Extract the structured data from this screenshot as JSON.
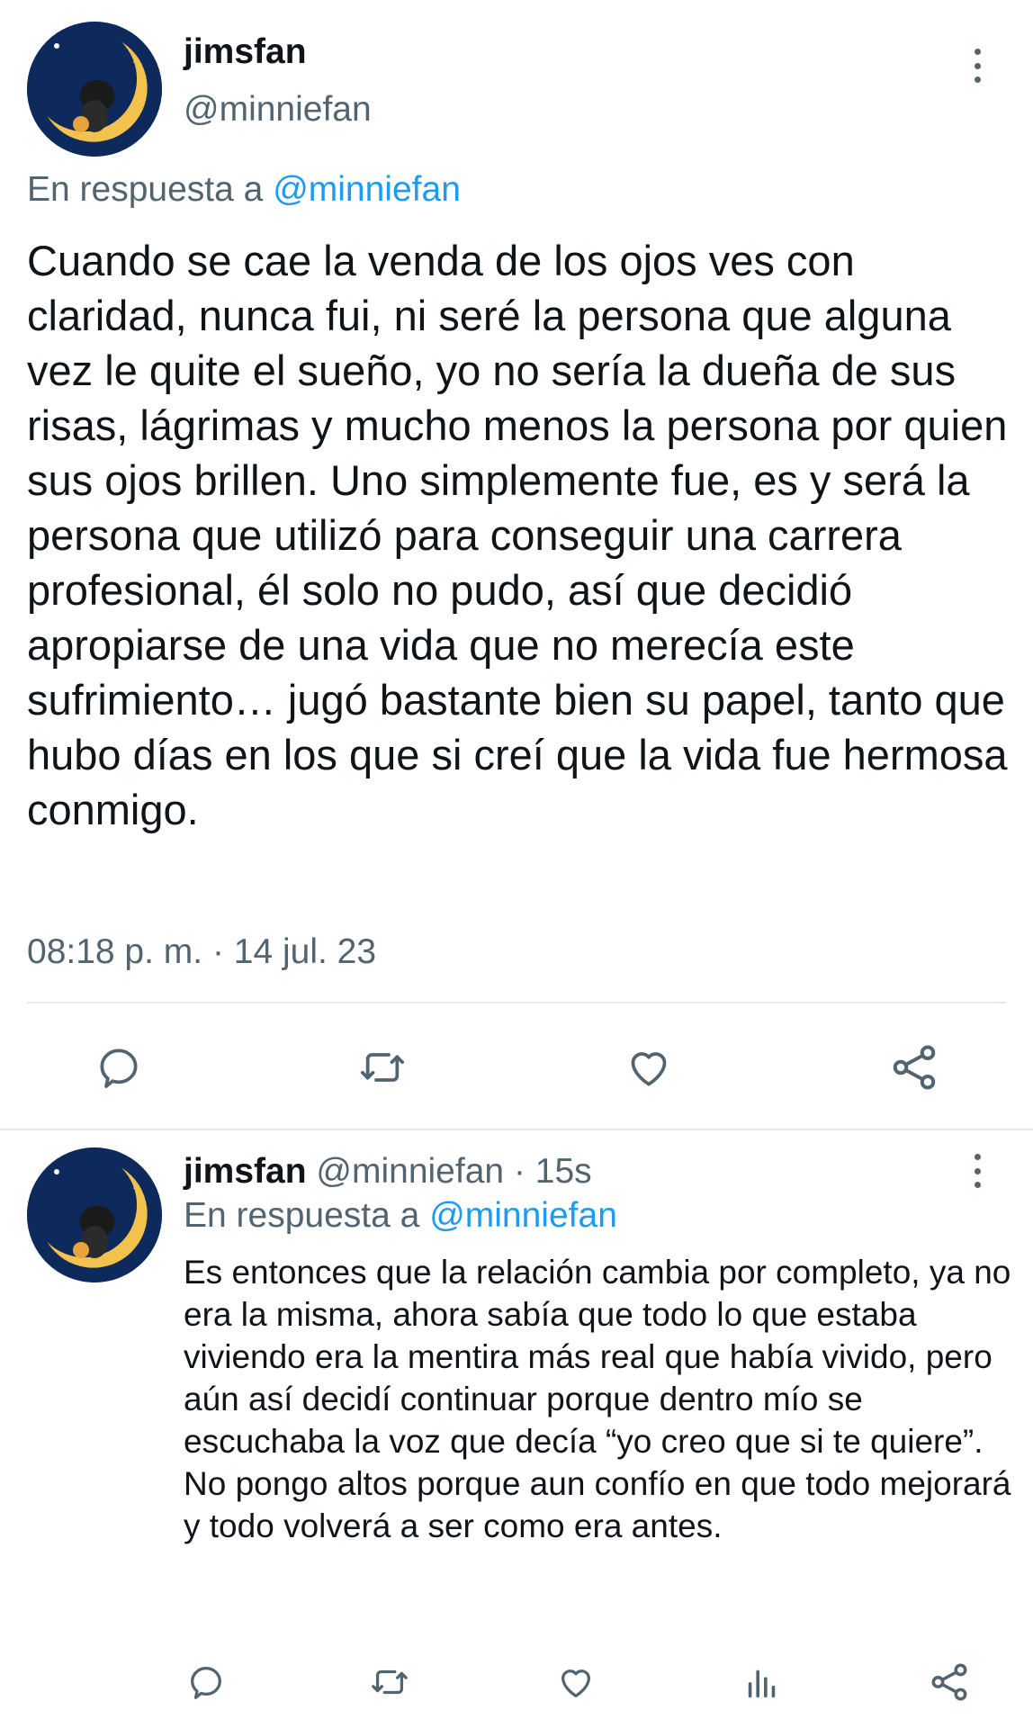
{
  "main_tweet": {
    "display_name": "jimsfan",
    "handle": "@minniefan",
    "reply_prefix": "En respuesta a",
    "reply_to": "@minniefan",
    "text": "Cuando se cae la venda de los ojos ves con claridad, nunca fui, ni seré la persona que alguna vez le quite el sueño, yo no sería la dueña de sus risas, lágrimas y mucho menos la persona por quien sus ojos brillen. Uno simplemente fue, es y será la persona que utilizó para conseguir una carrera profesional, él solo no pudo, así que decidió apropiarse de una vida que no merecía este sufrimiento… jugó bastante bien su papel, tanto que hubo días en los que si creí que la vida fue hermosa conmigo.",
    "timestamp": "08:18 p. m. · 14 jul. 23",
    "actions": [
      "reply-icon",
      "retweet-icon",
      "like-icon",
      "share-icon"
    ]
  },
  "reply_tweet": {
    "display_name": "jimsfan",
    "handle": "@minniefan",
    "time_ago": "· 15s",
    "reply_prefix": "En respuesta a",
    "reply_to": "@minniefan",
    "text": "Es entonces que la relación cambia por completo, ya no era la misma, ahora sabía que todo lo que estaba viviendo era la mentira más real que había vivido, pero aún así decidí continuar porque dentro mío se escuchaba la voz que decía “yo creo que si te quiere”. No pongo altos porque aun confío en que todo mejorará y todo volverá a ser como era antes.",
    "actions": [
      "reply-icon",
      "retweet-icon",
      "like-icon",
      "analytics-icon",
      "share-icon"
    ]
  },
  "colors": {
    "text": "#0f1419",
    "muted": "#536471",
    "link": "#1d9bf0",
    "divider": "#e6e9eb",
    "avatar_bg": "#0e2a5c",
    "moon": "#f2c14e"
  }
}
